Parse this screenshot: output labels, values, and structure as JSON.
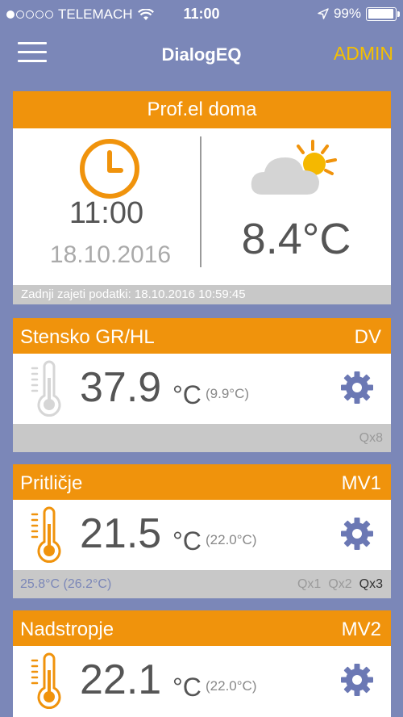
{
  "status_bar": {
    "carrier": "TELEMACH",
    "time": "11:00",
    "battery": "99%",
    "signal_dots_filled": 1,
    "signal_dots_total": 5
  },
  "nav": {
    "title": "DialogEQ",
    "admin_label": "ADMIN",
    "menu_icon": "hamburger-icon",
    "accent_color": "#f5c000"
  },
  "home": {
    "title": "Prof.el doma",
    "time": "11:00",
    "date": "18.10.2016",
    "outdoor_temp": "8.4°C",
    "last_data": "Zadnji zajeti podatki: 18.10.2016 10:59:45",
    "clock_icon": "clock-icon",
    "weather_icon": "partly-cloudy-icon"
  },
  "zones": [
    {
      "name": "Stensko GR/HL",
      "code": "DV",
      "temp": "37.9",
      "unit": "°C",
      "setpoint": "(9.9°C)",
      "thermometer": "thermometer-inactive-icon",
      "footer_left": "",
      "outputs": [
        "Qx8"
      ]
    },
    {
      "name": "Pritličje",
      "code": "MV1",
      "temp": "21.5",
      "unit": "°C",
      "setpoint": "(22.0°C)",
      "thermometer": "thermometer-active-icon",
      "footer_left": "25.8°C  (26.2°C)",
      "outputs": [
        "Qx1",
        "Qx2",
        "Qx3"
      ]
    },
    {
      "name": "Nadstropje",
      "code": "MV2",
      "temp": "22.1",
      "unit": "°C",
      "setpoint": "(22.0°C)",
      "thermometer": "thermometer-active-icon"
    }
  ],
  "colors": {
    "background": "#7b87b8",
    "header_orange": "#f0930c",
    "footer_gray": "#c8c8c8",
    "gear": "#6b78b4"
  }
}
